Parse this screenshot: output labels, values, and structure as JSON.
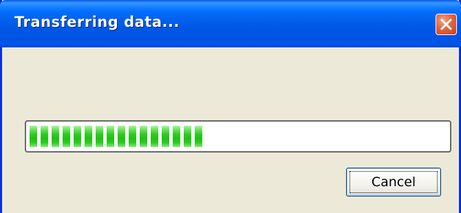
{
  "window": {
    "title": "Transferring data...",
    "close_icon": "close-icon"
  },
  "progress": {
    "value_percent": 45,
    "total_chunks": 36,
    "filled_chunks": 16,
    "fill_color": "#2ECB22"
  },
  "buttons": {
    "cancel_label": "Cancel"
  },
  "colors": {
    "titlebar": "#0055EB",
    "window_bg": "#ECE9D8",
    "close_button": "#E2653F"
  }
}
